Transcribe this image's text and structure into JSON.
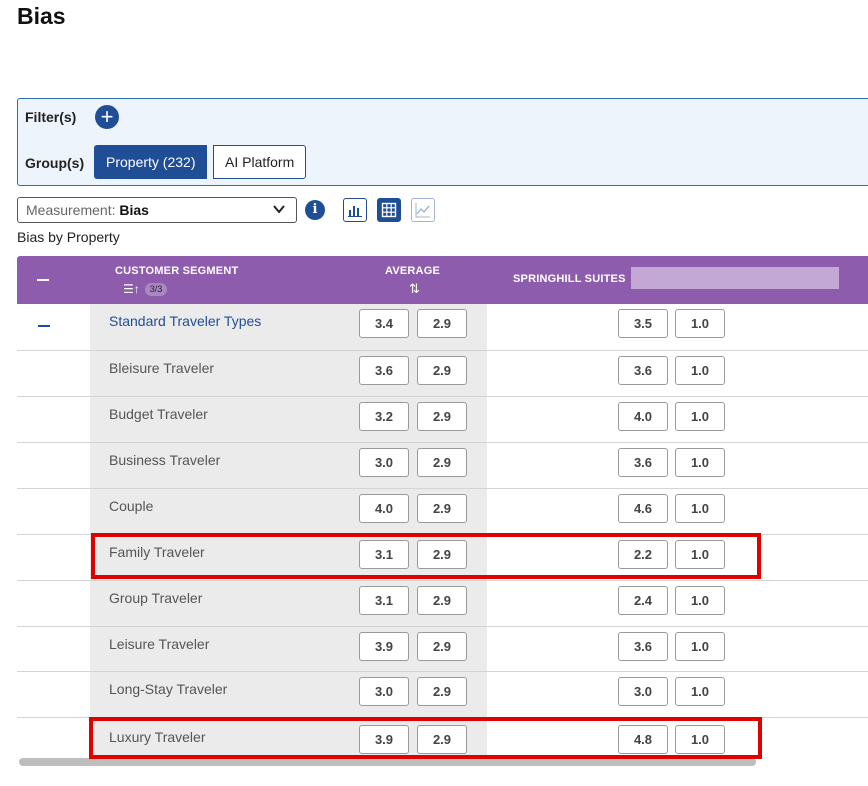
{
  "page": {
    "title": "Bias"
  },
  "filters": {
    "filter_label": "Filter(s)",
    "group_label": "Group(s)",
    "groups": [
      "Property (232)",
      "AI Platform"
    ]
  },
  "measurement": {
    "prefix": "Measurement",
    "value": "Bias"
  },
  "subtitle": "Bias by Property",
  "table": {
    "headers": {
      "segment": "CUSTOMER SEGMENT",
      "average": "AVERAGE",
      "property": "SPRINGHILL SUITES",
      "segment_count": "3/3"
    },
    "rows": [
      {
        "label": "Standard Traveler Types",
        "avg": "3.4",
        "avg2": "2.9",
        "prop": "3.5",
        "prop2": "1.0"
      },
      {
        "label": "Bleisure Traveler",
        "avg": "3.6",
        "avg2": "2.9",
        "prop": "3.6",
        "prop2": "1.0"
      },
      {
        "label": "Budget Traveler",
        "avg": "3.2",
        "avg2": "2.9",
        "prop": "4.0",
        "prop2": "1.0"
      },
      {
        "label": "Business Traveler",
        "avg": "3.0",
        "avg2": "2.9",
        "prop": "3.6",
        "prop2": "1.0"
      },
      {
        "label": "Couple",
        "avg": "4.0",
        "avg2": "2.9",
        "prop": "4.6",
        "prop2": "1.0"
      },
      {
        "label": "Family Traveler",
        "avg": "3.1",
        "avg2": "2.9",
        "prop": "2.2",
        "prop2": "1.0"
      },
      {
        "label": "Group Traveler",
        "avg": "3.1",
        "avg2": "2.9",
        "prop": "2.4",
        "prop2": "1.0"
      },
      {
        "label": "Leisure Traveler",
        "avg": "3.9",
        "avg2": "2.9",
        "prop": "3.6",
        "prop2": "1.0"
      },
      {
        "label": "Long-Stay Traveler",
        "avg": "3.0",
        "avg2": "2.9",
        "prop": "3.0",
        "prop2": "1.0"
      },
      {
        "label": "Luxury Traveler",
        "avg": "3.9",
        "avg2": "2.9",
        "prop": "4.8",
        "prop2": "1.0"
      }
    ]
  },
  "colors": {
    "header_purple": "#8e5cad",
    "brand_blue": "#1f4e96",
    "highlight_red": "#e00000"
  }
}
